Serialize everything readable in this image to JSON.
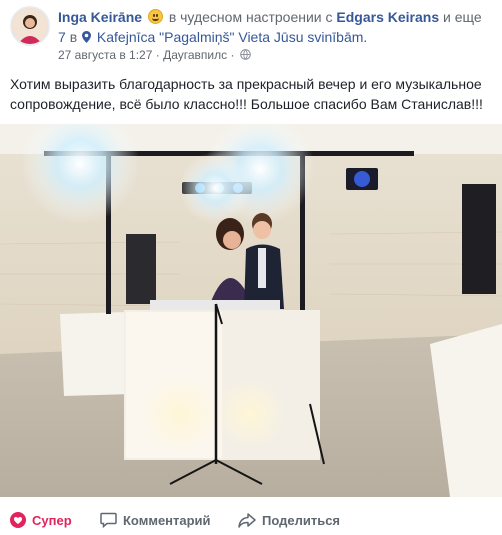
{
  "post": {
    "author": "Inga Keirāne",
    "feeling": "в чудесном настроении с",
    "tagged": "Edgars Keirans",
    "and_others": "и еще",
    "others_count": "7",
    "at_word": "в",
    "location": "Kafejnīca \"Pagalmiņš\" Vieta Jūsu svinībām.",
    "timestamp": "27 августа в 1:27",
    "place": "Даугавпилс",
    "separator": "·",
    "text": "Хотим выразить благодарность за прекрасный вечер и его музыкальное сопровождение, всё было классно!!! Большое спасибо Вам Станислав!!!"
  },
  "actions": {
    "like": "Супер",
    "comment": "Комментарий",
    "share": "Поделиться"
  },
  "colors": {
    "link": "#365899",
    "like": "#e0245e",
    "muted": "#616770"
  },
  "icons": [
    "avatar",
    "smiley-emoji-icon",
    "location-pin-icon",
    "globe-icon",
    "heart-reaction-icon",
    "comment-icon",
    "share-icon"
  ]
}
